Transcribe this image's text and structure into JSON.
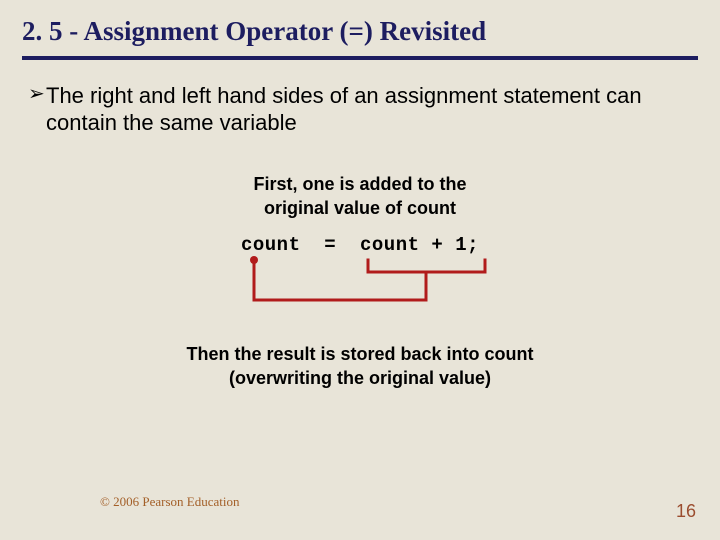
{
  "title": "2. 5 - Assignment Operator (=) Revisited",
  "bullet": "The right and left hand sides of an assignment statement can contain the same variable",
  "anno1_l1": "First, one is added to the",
  "anno1_l2": "original value of count",
  "code": "count  =  count + 1;",
  "anno2_l1": "Then the result is stored back into count",
  "anno2_l2": "(overwriting the original value)",
  "copyright": "© 2006 Pearson Education",
  "pagenum": "16"
}
